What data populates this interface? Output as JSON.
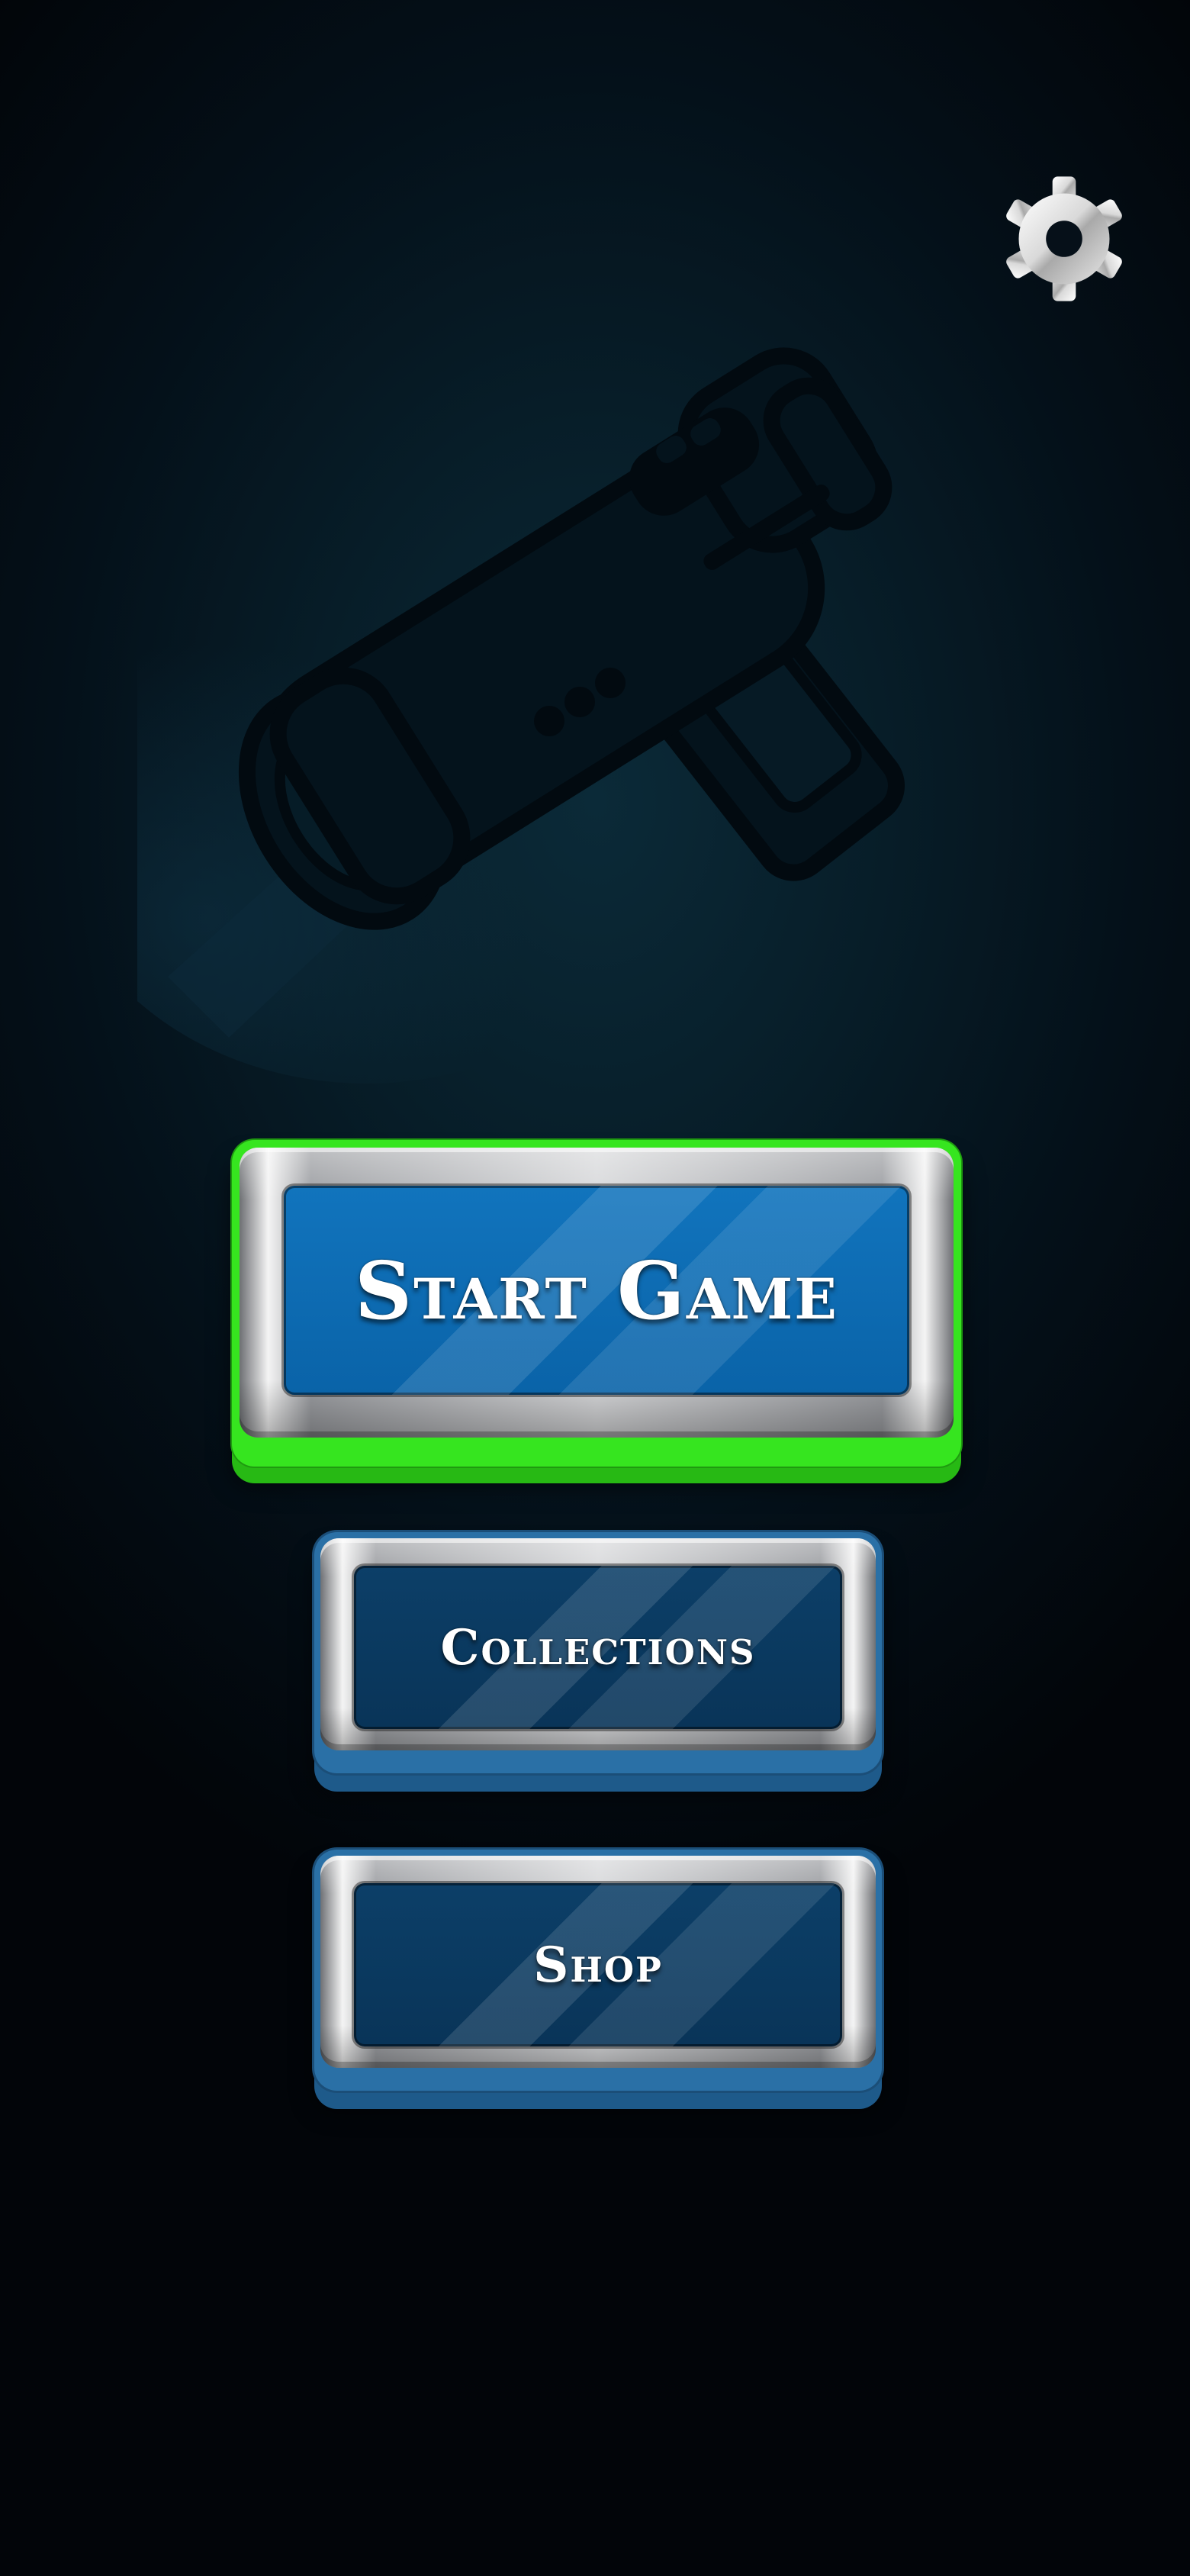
{
  "menu": {
    "start_label": "Start Game",
    "collections_label": "Collections",
    "shop_label": "Shop"
  },
  "settings": {
    "icon": "gear-icon"
  },
  "background": {
    "art": "blaster-illustration"
  },
  "colors": {
    "start_frame": "#36e51f",
    "start_panel": "#0a63a8",
    "secondary_frame": "#2a70a6",
    "secondary_panel": "#093458",
    "background": "#041019"
  }
}
